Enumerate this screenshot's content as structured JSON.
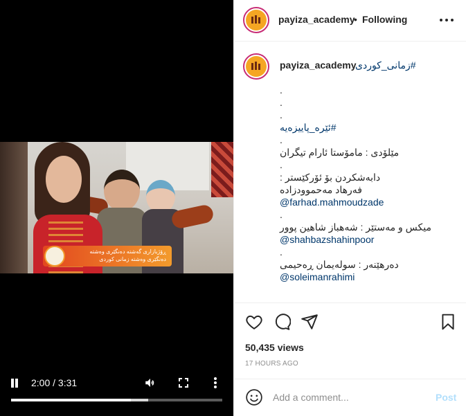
{
  "post": {
    "username": "payiza_academy",
    "follow_separator": "•",
    "follow_status": "Following",
    "hashtag_title": "#زمانی_کوردی",
    "caption_lines": [
      {
        "text": ".",
        "type": "text"
      },
      {
        "text": ".",
        "type": "text"
      },
      {
        "text": ".",
        "type": "text"
      },
      {
        "text": "#ئێرە_پاییزەیە",
        "type": "link"
      },
      {
        "text": ".",
        "type": "text"
      },
      {
        "text": "مێلۆدی : مامۆستا ئارام تیگران",
        "type": "text"
      },
      {
        "text": ".",
        "type": "text"
      },
      {
        "text": "دابەشکردن بۆ ئۆرکێستر :",
        "type": "text"
      },
      {
        "text": "فەرهاد مەحموودزادە",
        "type": "text"
      },
      {
        "text": "@farhad.mahmoudzade",
        "type": "link"
      },
      {
        "text": ".",
        "type": "text"
      },
      {
        "text": "میکس و مەستێر : شەهباز شاهین پوور",
        "type": "text"
      },
      {
        "text": "@shahbazshahinpoor",
        "type": "link"
      },
      {
        "text": ".",
        "type": "text"
      },
      {
        "text": "دەرهێنەر : سولەیمان ڕەحیمی",
        "type": "text"
      },
      {
        "text": "@soleimanrahimi",
        "type": "link"
      }
    ],
    "views": "50,435 views",
    "posted_ago": "17 HOURS AGO"
  },
  "video": {
    "current_time": "2:00",
    "duration": "3:31",
    "time_display": "2:00 / 3:31",
    "progress_fraction": 0.568,
    "buffered_fraction": 0.65,
    "lower_third_lines": [
      "ڕۆژبازاری گەشتە  دەنگێری وەشتە",
      "دەنگێری وەشتە  زمانی کوردی"
    ]
  },
  "comment": {
    "placeholder": "Add a comment...",
    "post_label": "Post"
  },
  "icons": {
    "avatar": "payiza-logo-icon",
    "like": "heart-icon",
    "comment": "comment-bubble-icon",
    "share": "paper-plane-icon",
    "save": "bookmark-icon",
    "emoji": "smiley-icon"
  },
  "colors": {
    "link": "#00376b",
    "story_ring": "#c72c75",
    "post_disabled": "#b2dffc",
    "muted": "#8e8e8e"
  }
}
